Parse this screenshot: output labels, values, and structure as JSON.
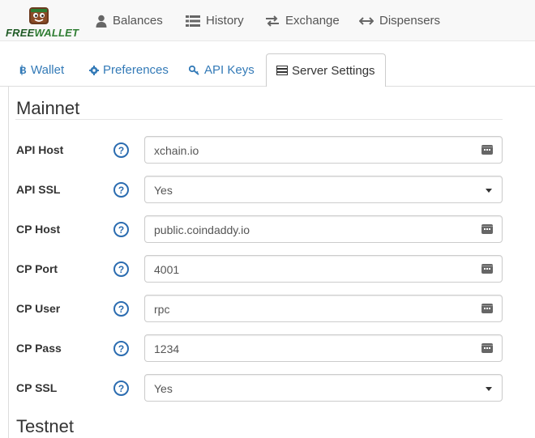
{
  "brand": {
    "free": "FREE",
    "wallet": "WALLET",
    "accent": "#2e7d32"
  },
  "nav": [
    {
      "label": "Balances",
      "icon": "user-icon"
    },
    {
      "label": "History",
      "icon": "list-icon"
    },
    {
      "label": "Exchange",
      "icon": "exchange-icon"
    },
    {
      "label": "Dispensers",
      "icon": "arrows-horizontal-icon"
    }
  ],
  "tabs": [
    {
      "label": "Wallet",
      "icon": "bitcoin-icon"
    },
    {
      "label": "Preferences",
      "icon": "gear-icon"
    },
    {
      "label": "API Keys",
      "icon": "key-icon"
    },
    {
      "label": "Server Settings",
      "icon": "server-icon",
      "active": true
    }
  ],
  "mainnet": {
    "title": "Mainnet",
    "rows": [
      {
        "label": "API Host",
        "value": "xchain.io",
        "type": "text"
      },
      {
        "label": "API SSL",
        "value": "Yes",
        "type": "select"
      },
      {
        "label": "CP Host",
        "value": "public.coindaddy.io",
        "type": "text"
      },
      {
        "label": "CP Port",
        "value": "4001",
        "type": "text"
      },
      {
        "label": "CP User",
        "value": "rpc",
        "type": "text"
      },
      {
        "label": "CP Pass",
        "value": "1234",
        "type": "text"
      },
      {
        "label": "CP SSL",
        "value": "Yes",
        "type": "select"
      }
    ]
  },
  "testnet": {
    "title": "Testnet"
  },
  "help_glyph": "?",
  "colors": {
    "link": "#337ab7",
    "help": "#2b6cb0"
  }
}
